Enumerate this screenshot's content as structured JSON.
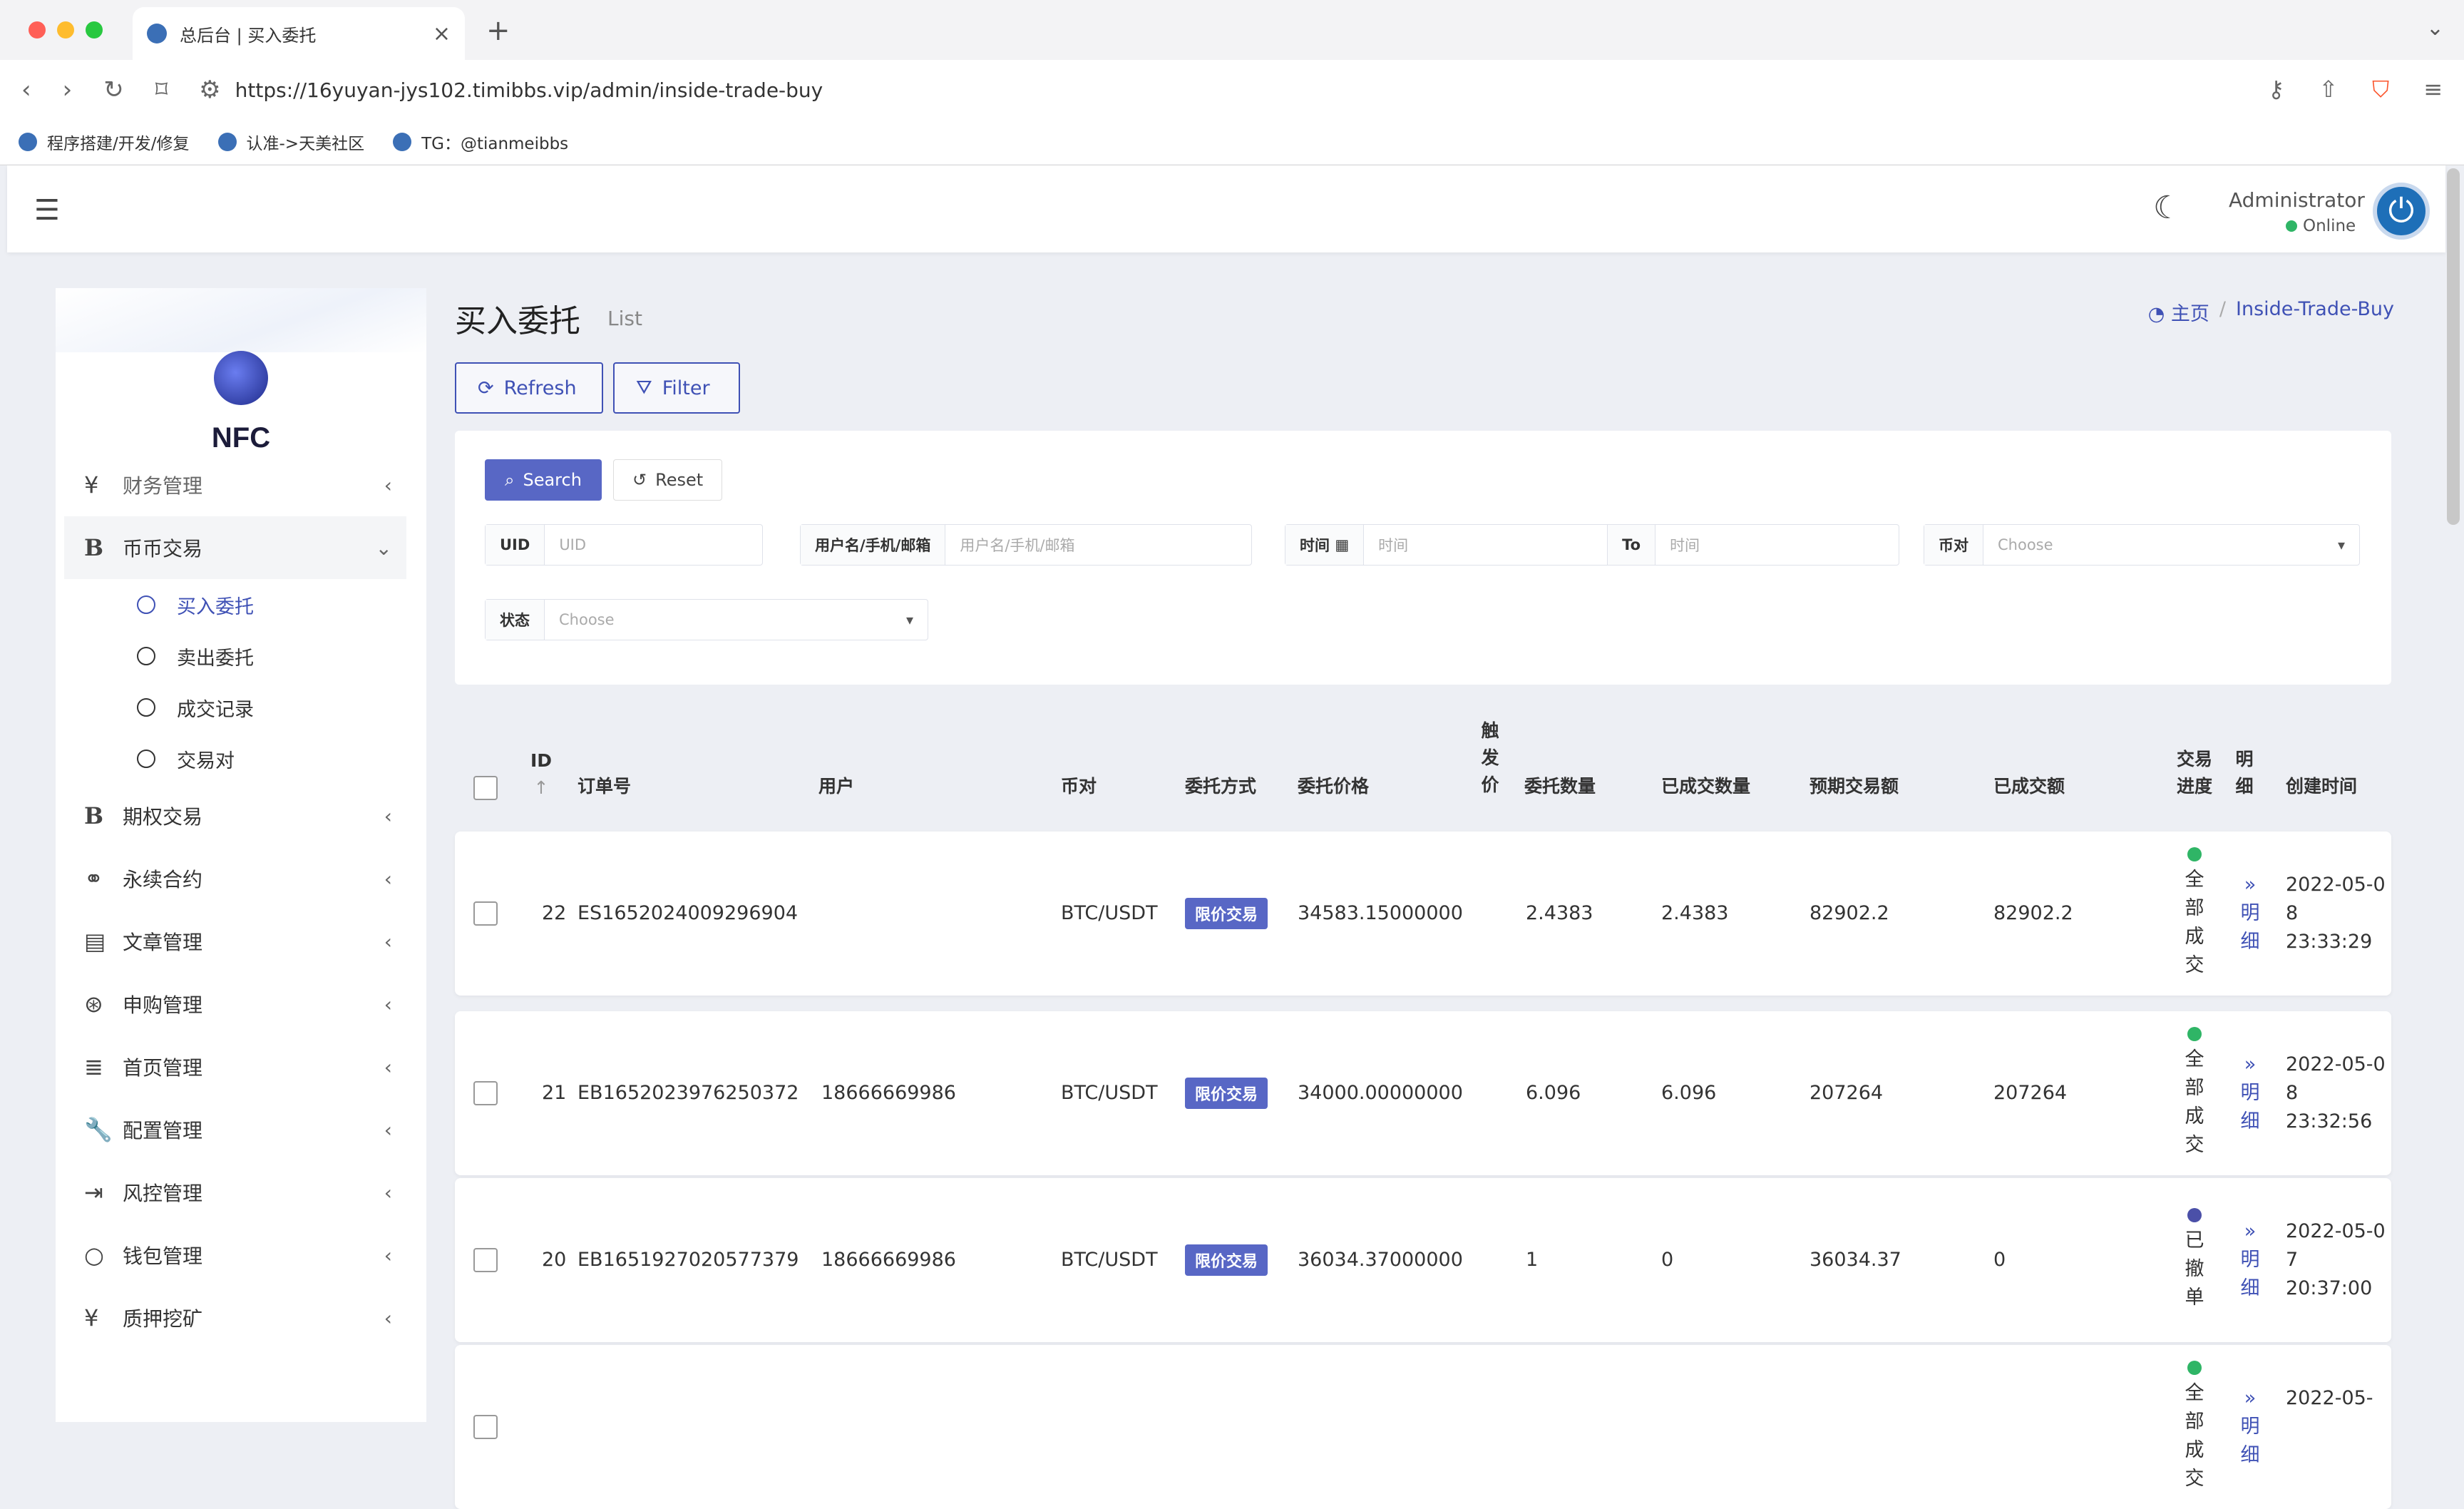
{
  "browser": {
    "tab_title": "总后台 | 买入委托",
    "url": "https://16yuyan-jys102.timibbs.vip/admin/inside-trade-buy",
    "bookmarks": [
      "程序搭建/开发/修复",
      "认准->天美社区",
      "TG：@tianmeibbs"
    ]
  },
  "header": {
    "user_name": "Administrator",
    "status": "Online"
  },
  "sidebar": {
    "brand": "NFC",
    "partial_item": "财务管理",
    "items": [
      {
        "label": "币币交易",
        "icon": "B",
        "expanded": true
      },
      {
        "label": "期权交易",
        "icon": "B"
      },
      {
        "label": "永续合约",
        "icon": "link-icon"
      },
      {
        "label": "文章管理",
        "icon": "newspaper-icon"
      },
      {
        "label": "申购管理",
        "icon": "lifebuoy-icon"
      },
      {
        "label": "首页管理",
        "icon": "bars-icon"
      },
      {
        "label": "配置管理",
        "icon": "wrench-icon"
      },
      {
        "label": "风控管理",
        "icon": "indent-icon"
      },
      {
        "label": "钱包管理",
        "icon": "circle-icon"
      },
      {
        "label": "质押挖矿",
        "icon": "yen-icon"
      }
    ],
    "subitems": [
      "买入委托",
      "卖出委托",
      "成交记录",
      "交易对"
    ]
  },
  "page": {
    "title": "买入委托",
    "subtitle": "List",
    "breadcrumb_home": "主页",
    "breadcrumb_current": "Inside-Trade-Buy",
    "refresh_label": "Refresh",
    "filter_label": "Filter"
  },
  "filter": {
    "search_label": "Search",
    "reset_label": "Reset",
    "uid_label": "UID",
    "uid_placeholder": "UID",
    "user_label": "用户名/手机/邮箱",
    "user_placeholder": "用户名/手机/邮箱",
    "time_label": "时间",
    "time_placeholder": "时间",
    "to_label": "To",
    "to_placeholder": "时间",
    "pair_label": "币对",
    "pair_placeholder": "Choose",
    "status_label": "状态",
    "status_placeholder": "Choose"
  },
  "table": {
    "headers": {
      "id": "ID",
      "order_no": "订单号",
      "user": "用户",
      "pair": "币对",
      "method": "委托方式",
      "price": "委托价格",
      "trigger": "触发价",
      "qty": "委托数量",
      "filled_qty": "已成交数量",
      "expected": "预期交易额",
      "filled_amt": "已成交额",
      "progress": "交易进度",
      "detail": "明细",
      "created": "创建时间"
    },
    "rows": [
      {
        "id": "22",
        "order_no": "ES1652024009296904",
        "user": "",
        "pair": "BTC/USDT",
        "method": "限价交易",
        "price": "34583.15000000",
        "qty": "2.4383",
        "filled_qty": "2.4383",
        "expected": "82902.2",
        "filled_amt": "82902.2",
        "progress": "全部成交",
        "progress_color": "#2fb566",
        "detail": "» 明细",
        "created_date": "2022-05-08",
        "created_time": "23:33:29"
      },
      {
        "id": "21",
        "order_no": "EB1652023976250372",
        "user": "18666669986",
        "pair": "BTC/USDT",
        "method": "限价交易",
        "price": "34000.00000000",
        "qty": "6.096",
        "filled_qty": "6.096",
        "expected": "207264",
        "filled_amt": "207264",
        "progress": "全部成交",
        "progress_color": "#2fb566",
        "detail": "» 明细",
        "created_date": "2022-05-08",
        "created_time": "23:32:56"
      },
      {
        "id": "20",
        "order_no": "EB1651927020577379",
        "user": "18666669986",
        "pair": "BTC/USDT",
        "method": "限价交易",
        "price": "36034.37000000",
        "qty": "1",
        "filled_qty": "0",
        "expected": "36034.37",
        "filled_amt": "0",
        "progress": "已撤单",
        "progress_color": "#4b50a8",
        "detail": "» 明细",
        "created_date": "2022-05-07",
        "created_time": "20:37:00"
      },
      {
        "id": "",
        "order_no": "",
        "user": "",
        "pair": "",
        "method": "",
        "price": "",
        "qty": "",
        "filled_qty": "",
        "expected": "",
        "filled_amt": "",
        "progress": "全部成交",
        "progress_color": "#2fb566",
        "detail": "» 明细",
        "created_date": "2022-05-",
        "created_time": ""
      }
    ]
  },
  "colors": {
    "primary": "#3f51b5",
    "success": "#2fb566",
    "cancelled": "#4b50a8"
  }
}
